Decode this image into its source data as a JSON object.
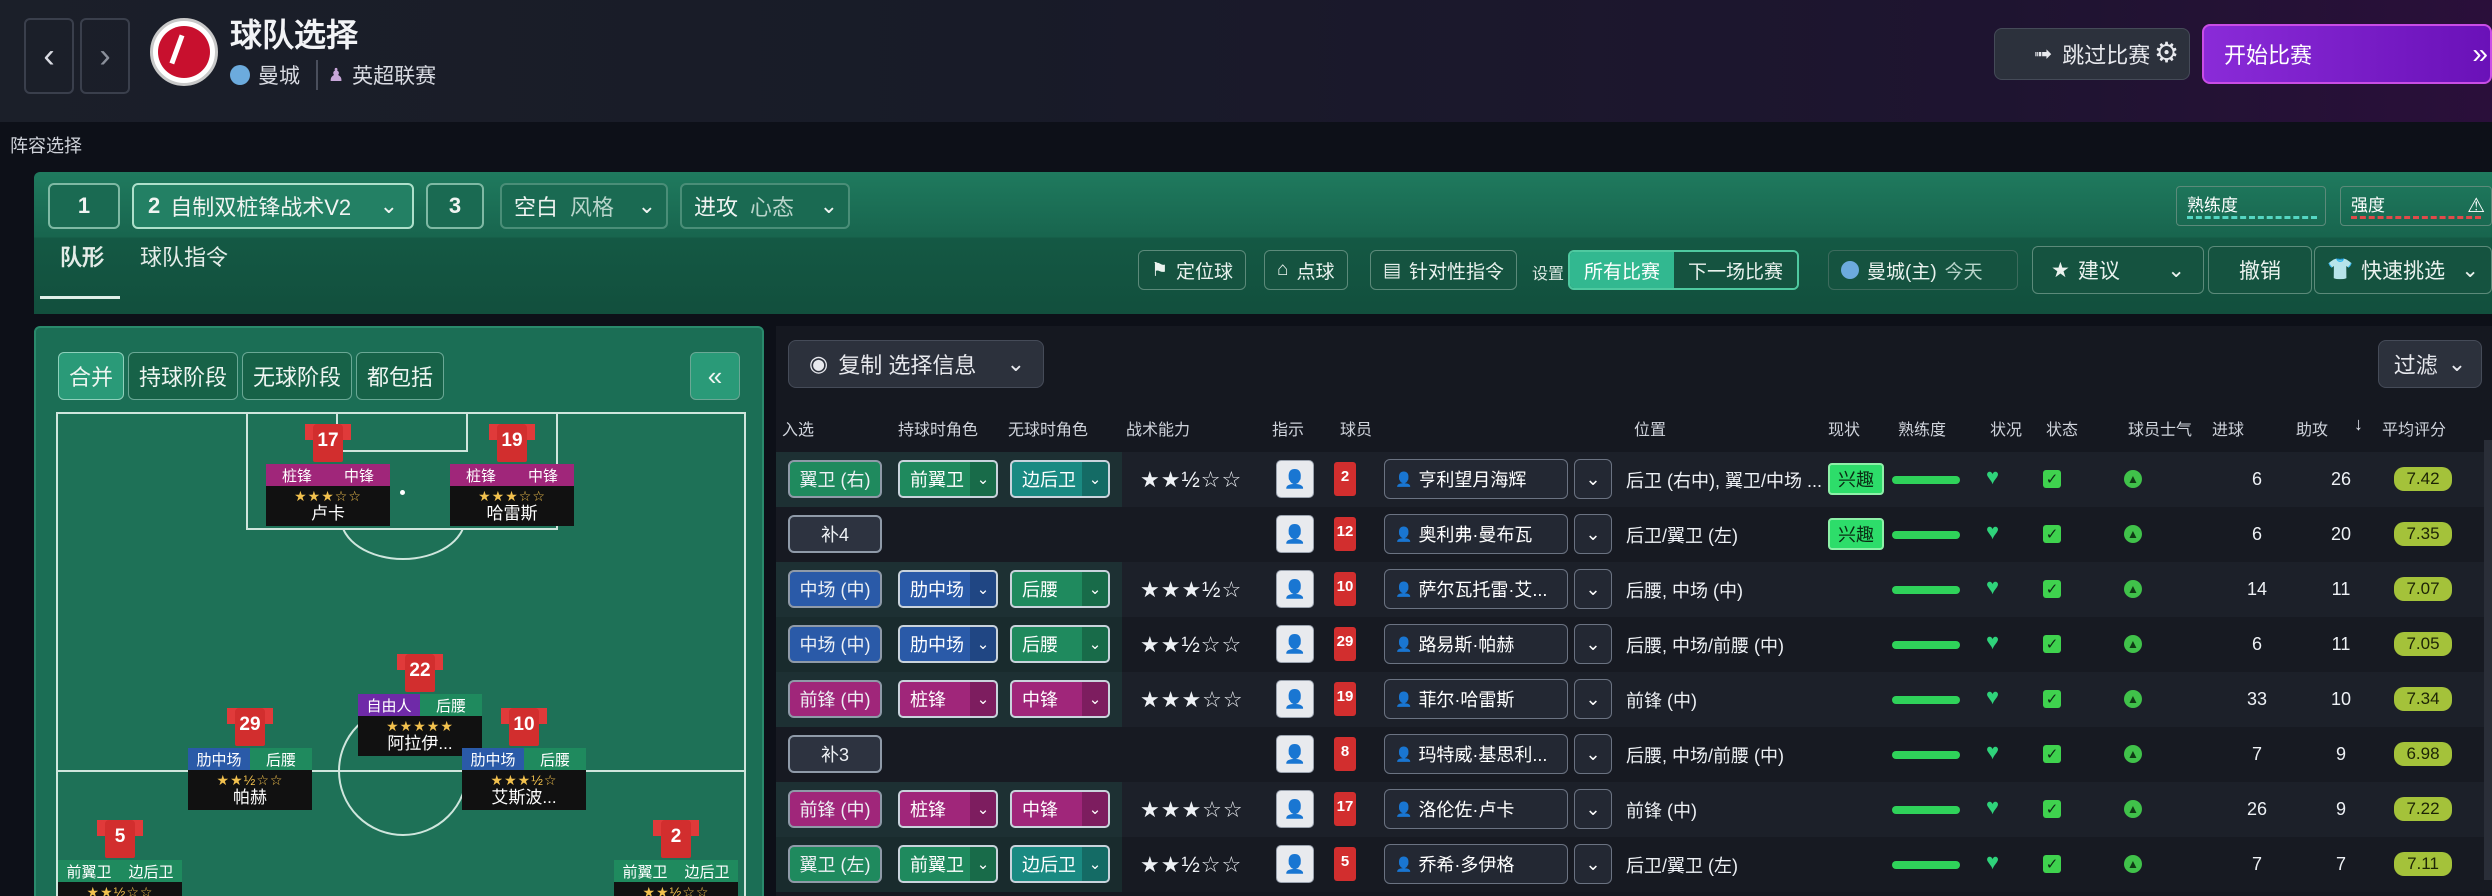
{
  "header": {
    "title": "球队选择",
    "team": "曼城",
    "league": "英超联赛",
    "skip_label": "跳过比赛",
    "start_label": "开始比赛"
  },
  "section_label": "阵容选择",
  "tactic_bar": {
    "slot1": "1",
    "slot2_num": "2",
    "slot2_name": "自制双桩锋战术V2",
    "slot3": "3",
    "style_value": "空白",
    "style_label": "风格",
    "mentality_value": "进攻",
    "mentality_label": "心态",
    "familiarity_label": "熟练度",
    "intensity_label": "强度"
  },
  "tabs": [
    "队形",
    "球队指令"
  ],
  "toolbar": {
    "set_pieces": "定位球",
    "penalties": "点球",
    "opposition": "针对性指令",
    "settings_label": "设置",
    "all_matches": "所有比赛",
    "next_match": "下一场比赛",
    "next_opponent": "曼城(主)",
    "next_when": "今天",
    "advice": "建议",
    "undo": "撤销",
    "quick_pick": "快速挑选"
  },
  "phase_buttons": [
    "合并",
    "持球阶段",
    "无球阶段",
    "都包括"
  ],
  "pitch_players": [
    {
      "num": "17",
      "r1": "桩锋",
      "r2": "中锋",
      "stars": "★★★☆☆",
      "name": "卢卡",
      "c1": "#a0267a",
      "c2": "#a0267a"
    },
    {
      "num": "19",
      "r1": "桩锋",
      "r2": "中锋",
      "stars": "★★★☆☆",
      "name": "哈雷斯",
      "c1": "#a0267a",
      "c2": "#a0267a"
    },
    {
      "num": "22",
      "r1": "自由人",
      "r2": "后腰",
      "stars": "★★★★★",
      "name": "阿拉伊...",
      "c1": "#6f2aa8",
      "c2": "#1f8a5e"
    },
    {
      "num": "29",
      "r1": "肋中场",
      "r2": "后腰",
      "stars": "★★½☆☆",
      "name": "帕赫",
      "c1": "#2a5aa8",
      "c2": "#1f8a5e"
    },
    {
      "num": "10",
      "r1": "肋中场",
      "r2": "后腰",
      "stars": "★★★½☆",
      "name": "艾斯波...",
      "c1": "#2a5aa8",
      "c2": "#1f8a5e"
    },
    {
      "num": "5",
      "r1": "前翼卫",
      "r2": "边后卫",
      "stars": "★★½☆☆",
      "name": "",
      "c1": "#1f8a5e",
      "c2": "#1f8a5e"
    },
    {
      "num": "2",
      "r1": "前翼卫",
      "r2": "边后卫",
      "stars": "★★½☆☆",
      "name": "",
      "c1": "#1f8a5e",
      "c2": "#1f8a5e"
    }
  ],
  "list": {
    "copy_label": "复制 选择信息",
    "filter_label": "过滤",
    "headers": [
      "入选",
      "持球时角色",
      "无球时角色",
      "战术能力",
      "指示",
      "球员",
      "位置",
      "现状",
      "熟练度",
      "状况",
      "状态",
      "球员士气",
      "进球",
      "助攻",
      "平均评分"
    ],
    "rows": [
      {
        "sel": "翼卫 (右)",
        "rin": "前翼卫",
        "rout": "边后卫",
        "stars": "★★½☆☆",
        "num": "2",
        "name": "亨利望月海辉",
        "pos": "后卫 (右中), 翼卫/中场 ...",
        "tag": "兴趣",
        "goals": "6",
        "assists": "26",
        "rating": "7.42",
        "c1": "#1f8a5e",
        "c2": "#1a8a82",
        "selc": "#1f8a5e"
      },
      {
        "sel": "补4",
        "rin": "",
        "rout": "",
        "stars": "",
        "num": "12",
        "name": "奥利弗·曼布瓦",
        "pos": "后卫/翼卫 (左)",
        "tag": "兴趣",
        "goals": "6",
        "assists": "20",
        "rating": "7.35",
        "c1": "",
        "c2": "",
        "selc": ""
      },
      {
        "sel": "中场 (中)",
        "rin": "肋中场",
        "rout": "后腰",
        "stars": "★★★½☆",
        "num": "10",
        "name": "萨尔瓦托雷·艾...",
        "pos": "后腰, 中场 (中)",
        "tag": "",
        "goals": "14",
        "assists": "11",
        "rating": "7.07",
        "c1": "#2a5aa8",
        "c2": "#1f8a5e",
        "selc": "#2a5aa8"
      },
      {
        "sel": "中场 (中)",
        "rin": "肋中场",
        "rout": "后腰",
        "stars": "★★½☆☆",
        "num": "29",
        "name": "路易斯·帕赫",
        "pos": "后腰, 中场/前腰 (中)",
        "tag": "",
        "goals": "6",
        "assists": "11",
        "rating": "7.05",
        "c1": "#2a5aa8",
        "c2": "#1f8a5e",
        "selc": "#2a5aa8"
      },
      {
        "sel": "前锋 (中)",
        "rin": "桩锋",
        "rout": "中锋",
        "stars": "★★★☆☆",
        "num": "19",
        "name": "菲尔·哈雷斯",
        "pos": "前锋 (中)",
        "tag": "",
        "goals": "33",
        "assists": "10",
        "rating": "7.34",
        "c1": "#a0267a",
        "c2": "#a0267a",
        "selc": "#a0267a"
      },
      {
        "sel": "补3",
        "rin": "",
        "rout": "",
        "stars": "",
        "num": "8",
        "name": "玛特威·基思利...",
        "pos": "后腰, 中场/前腰 (中)",
        "tag": "",
        "goals": "7",
        "assists": "9",
        "rating": "6.98",
        "c1": "",
        "c2": "",
        "selc": ""
      },
      {
        "sel": "前锋 (中)",
        "rin": "桩锋",
        "rout": "中锋",
        "stars": "★★★☆☆",
        "num": "17",
        "name": "洛伦佐·卢卡",
        "pos": "前锋 (中)",
        "tag": "",
        "goals": "26",
        "assists": "9",
        "rating": "7.22",
        "c1": "#a0267a",
        "c2": "#a0267a",
        "selc": "#a0267a"
      },
      {
        "sel": "翼卫 (左)",
        "rin": "前翼卫",
        "rout": "边后卫",
        "stars": "★★½☆☆",
        "num": "5",
        "name": "乔希·多伊格",
        "pos": "后卫/翼卫 (左)",
        "tag": "",
        "goals": "7",
        "assists": "7",
        "rating": "7.11",
        "c1": "#1f8a5e",
        "c2": "#1a8a82",
        "selc": "#1f8a5e"
      }
    ]
  },
  "colors": {
    "accent": "#1f7a5e",
    "start": "#8a2bd8",
    "rating": "#a4c23a"
  }
}
